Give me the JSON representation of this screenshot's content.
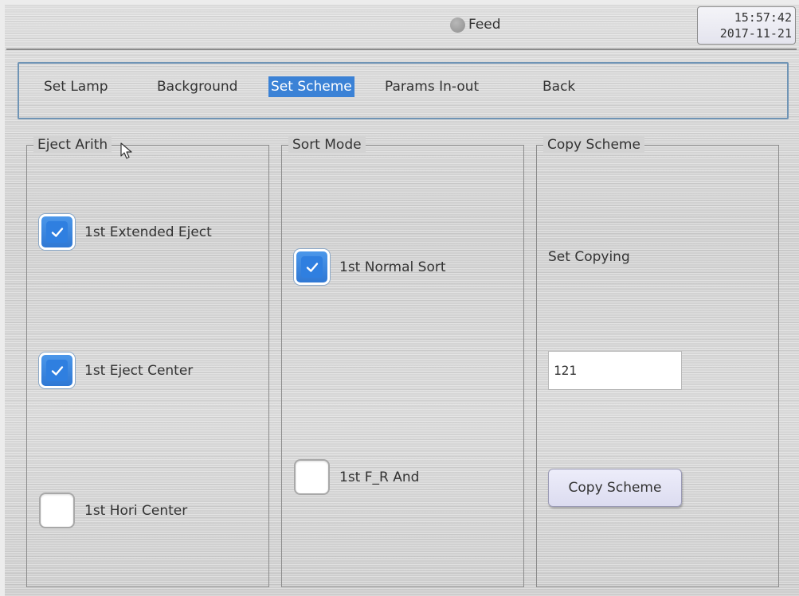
{
  "header": {
    "status_label": "Feed",
    "time": "15:57:42",
    "date": "2017-11-21"
  },
  "menu": {
    "items": [
      {
        "label": "Set Lamp"
      },
      {
        "label": "Background"
      },
      {
        "label": "Set Scheme",
        "active": true
      },
      {
        "label": "Params In-out"
      },
      {
        "label": "Back"
      }
    ]
  },
  "eject_arith": {
    "title": "Eject Arith",
    "options": [
      {
        "label": "1st Extended Eject",
        "checked": true
      },
      {
        "label": "1st Eject Center",
        "checked": true
      },
      {
        "label": "1st Hori Center",
        "checked": false
      }
    ]
  },
  "sort_mode": {
    "title": "Sort Mode",
    "options": [
      {
        "label": "1st Normal Sort",
        "checked": true
      },
      {
        "label": "1st F_R And",
        "checked": false
      }
    ]
  },
  "copy_scheme": {
    "title": "Copy Scheme",
    "set_copying_label": "Set Copying",
    "input_value": "121",
    "button_label": "Copy Scheme"
  },
  "colors": {
    "accent": "#3b82d6",
    "menu_border": "#6f94b5"
  },
  "icons": {
    "check": "checkmark-icon",
    "status": "status-dot-icon",
    "pointer": "mouse-pointer-icon"
  }
}
